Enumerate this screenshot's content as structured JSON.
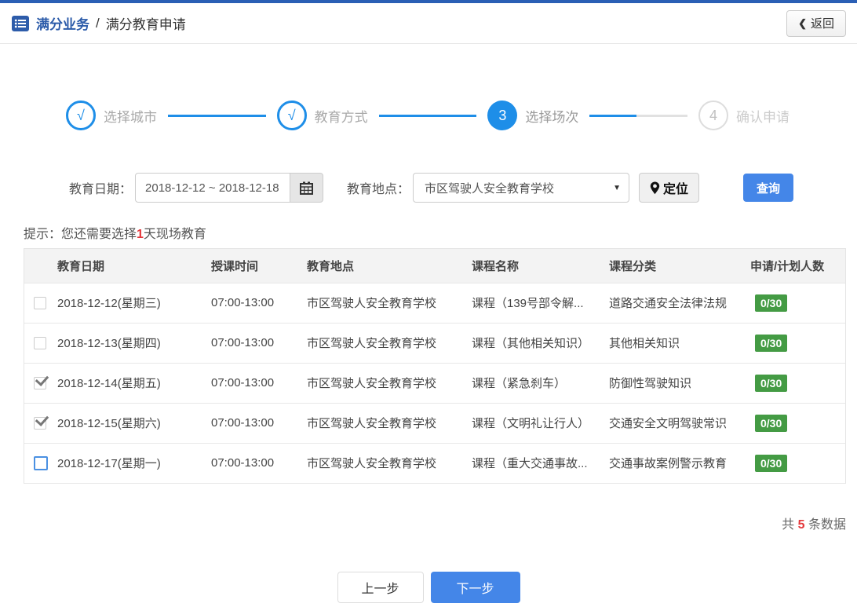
{
  "colors": {
    "topbar_blue": "#2b5fb5",
    "title_blue": "#2d5caa",
    "step_blue": "#1e8ee8",
    "button_blue": "#4486e8",
    "badge_green": "#449b44",
    "alert_red": "#e4393c"
  },
  "header": {
    "title": "满分业务",
    "separator": "/",
    "subtitle": "满分教育申请",
    "back_chevron": "❮",
    "back_label": "返回"
  },
  "steps": [
    {
      "marker": "√",
      "label": "选择城市",
      "state": "done"
    },
    {
      "marker": "√",
      "label": "教育方式",
      "state": "done"
    },
    {
      "marker": "3",
      "label": "选择场次",
      "state": "active"
    },
    {
      "marker": "4",
      "label": "确认申请",
      "state": "pending"
    }
  ],
  "filters": {
    "date_label": "教育日期：",
    "date_value": "2018-12-12 ~ 2018-12-18",
    "location_label": "教育地点：",
    "location_value": "市区驾驶人安全教育学校",
    "dropdown_arrow": "▼",
    "locate_label": "定位",
    "search_label": "查询"
  },
  "hint": {
    "prefix": "提示：您还需要选择",
    "highlight": "1",
    "suffix": "天现场教育"
  },
  "table": {
    "headers": [
      "教育日期",
      "授课时间",
      "教育地点",
      "课程名称",
      "课程分类",
      "申请/计划人数"
    ],
    "rows": [
      {
        "checked": false,
        "focus": false,
        "date": "2018-12-12(星期三)",
        "time": "07:00-13:00",
        "location": "市区驾驶人安全教育学校",
        "course": "课程（139号部令解...",
        "category": "道路交通安全法律法规",
        "count": "0/30"
      },
      {
        "checked": false,
        "focus": false,
        "date": "2018-12-13(星期四)",
        "time": "07:00-13:00",
        "location": "市区驾驶人安全教育学校",
        "course": "课程（其他相关知识）",
        "category": "其他相关知识",
        "count": "0/30"
      },
      {
        "checked": true,
        "focus": false,
        "date": "2018-12-14(星期五)",
        "time": "07:00-13:00",
        "location": "市区驾驶人安全教育学校",
        "course": "课程（紧急刹车）",
        "category": "防御性驾驶知识",
        "count": "0/30"
      },
      {
        "checked": true,
        "focus": false,
        "date": "2018-12-15(星期六)",
        "time": "07:00-13:00",
        "location": "市区驾驶人安全教育学校",
        "course": "课程（文明礼让行人）",
        "category": "交通安全文明驾驶常识",
        "count": "0/30"
      },
      {
        "checked": false,
        "focus": true,
        "date": "2018-12-17(星期一)",
        "time": "07:00-13:00",
        "location": "市区驾驶人安全教育学校",
        "course": "课程（重大交通事故...",
        "category": "交通事故案例警示教育",
        "count": "0/30"
      }
    ]
  },
  "summary": {
    "prefix": "共",
    "count": "5",
    "suffix": "条数据"
  },
  "footer": {
    "prev_label": "上一步",
    "next_label": "下一步"
  }
}
